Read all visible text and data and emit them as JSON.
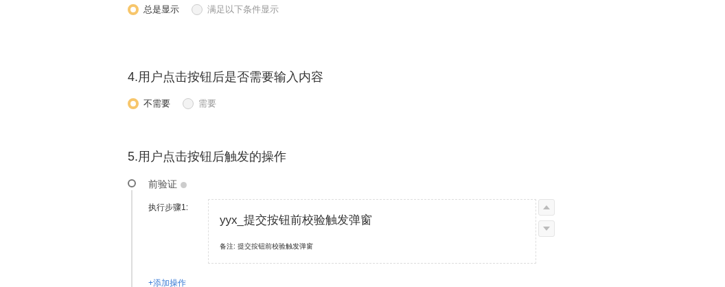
{
  "display_condition": {
    "options": [
      {
        "label": "总是显示",
        "selected": true
      },
      {
        "label": "满足以下条件显示",
        "selected": false
      }
    ]
  },
  "question_4": {
    "title": "4.用户点击按钮后是否需要输入内容",
    "options": [
      {
        "label": "不需要",
        "selected": true
      },
      {
        "label": "需要",
        "selected": false
      }
    ]
  },
  "question_5": {
    "title": "5.用户点击按钮后触发的操作",
    "stage": {
      "name": "前验证",
      "steps": [
        {
          "label": "执行步骤1:",
          "action": "yyx_提交按钮前校验触发弹窗",
          "note": "备注: 提交按钮前校验触发弹窗"
        }
      ],
      "add_label": "+添加操作"
    }
  }
}
